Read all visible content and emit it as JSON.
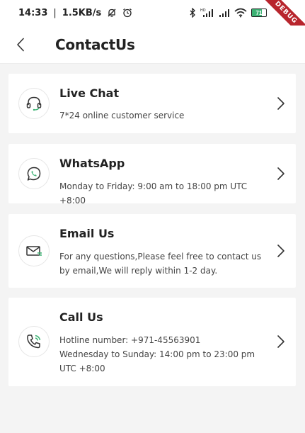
{
  "status_bar": {
    "time": "14:33",
    "speed": "1.5KB/s",
    "battery": "71",
    "debug_label": "DEBUG"
  },
  "header": {
    "title": "ContactUs"
  },
  "contacts": [
    {
      "title": "Live Chat",
      "desc": "7*24 online customer service",
      "icon": "headset-icon"
    },
    {
      "title": "WhatsApp",
      "desc": "Monday to Friday: 9:00 am to 18:00 pm UTC +8:00",
      "icon": "whatsapp-icon"
    },
    {
      "title": "Email Us",
      "desc": "For any questions,Please feel free to contact us by email,We will reply within 1-2 day.",
      "icon": "email-icon"
    },
    {
      "title": "Call Us",
      "desc_line1": "Hotline number: +971-45563901",
      "desc_line2": "Wednesday to Sunday: 14:00 pm to 23:00 pm UTC +8:00",
      "icon": "phone-icon"
    }
  ],
  "colors": {
    "accent": "#3bb273",
    "debug": "#b8252d"
  }
}
